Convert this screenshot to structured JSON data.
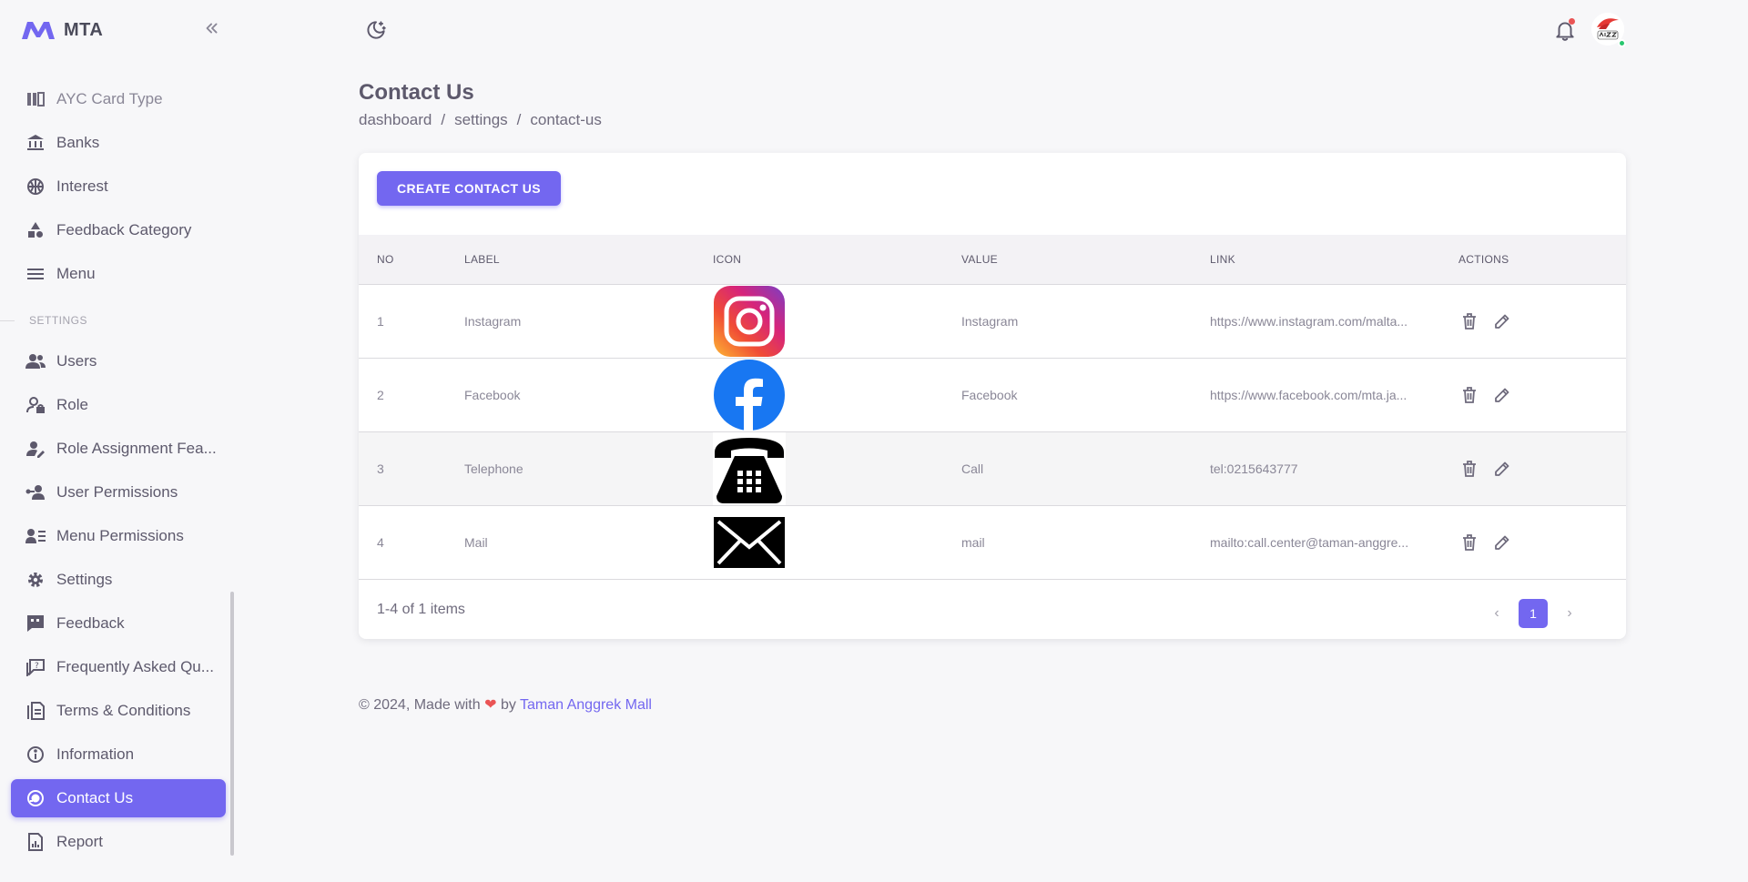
{
  "brand": {
    "name": "MTA"
  },
  "sidebar": {
    "items_top": [
      {
        "label": "AYC Card Type",
        "icon": "card-type-icon"
      },
      {
        "label": "Banks",
        "icon": "bank-icon"
      },
      {
        "label": "Interest",
        "icon": "basketball-icon"
      },
      {
        "label": "Feedback Category",
        "icon": "shapes-icon"
      },
      {
        "label": "Menu",
        "icon": "menu-icon"
      }
    ],
    "section_label": "SETTINGS",
    "items_settings": [
      {
        "label": "Users",
        "icon": "users-icon"
      },
      {
        "label": "Role",
        "icon": "user-lock-icon"
      },
      {
        "label": "Role Assignment Fea...",
        "icon": "user-edit-icon"
      },
      {
        "label": "User Permissions",
        "icon": "user-key-icon"
      },
      {
        "label": "Menu Permissions",
        "icon": "user-list-icon"
      },
      {
        "label": "Settings",
        "icon": "gear-icon"
      },
      {
        "label": "Feedback",
        "icon": "quote-icon"
      },
      {
        "label": "Frequently Asked Qu...",
        "icon": "faq-icon"
      },
      {
        "label": "Terms & Conditions",
        "icon": "document-icon"
      },
      {
        "label": "Information",
        "icon": "info-icon"
      },
      {
        "label": "Contact Us",
        "icon": "support-icon",
        "active": true
      },
      {
        "label": "Report",
        "icon": "report-icon"
      }
    ]
  },
  "header": {
    "title": "Contact Us",
    "breadcrumb": [
      "dashboard",
      "settings",
      "contact-us"
    ]
  },
  "toolbar": {
    "create_label": "CREATE CONTACT US"
  },
  "table": {
    "columns": [
      "NO",
      "LABEL",
      "ICON",
      "VALUE",
      "LINK",
      "ACTIONS"
    ],
    "rows": [
      {
        "no": "1",
        "label": "Instagram",
        "icon": "instagram-icon",
        "value": "Instagram",
        "link": "https://www.instagram.com/malta..."
      },
      {
        "no": "2",
        "label": "Facebook",
        "icon": "facebook-icon",
        "value": "Facebook",
        "link": "https://www.facebook.com/mta.ja..."
      },
      {
        "no": "3",
        "label": "Telephone",
        "icon": "telephone-icon",
        "value": "Call",
        "link": "tel:0215643777"
      },
      {
        "no": "4",
        "label": "Mail",
        "icon": "mail-icon",
        "value": "mail",
        "link": "mailto:call.center@taman-anggre..."
      }
    ]
  },
  "pagination": {
    "info": "1-4 of 1 items",
    "current_page": "1",
    "prev": "‹",
    "next": "›"
  },
  "footer": {
    "prefix": "© 2024, Made with",
    "heart": "❤",
    "by": "by",
    "company": "Taman Anggrek Mall"
  },
  "colors": {
    "primary": "#7367f0",
    "danger": "#ea5455",
    "success": "#28c76f"
  }
}
